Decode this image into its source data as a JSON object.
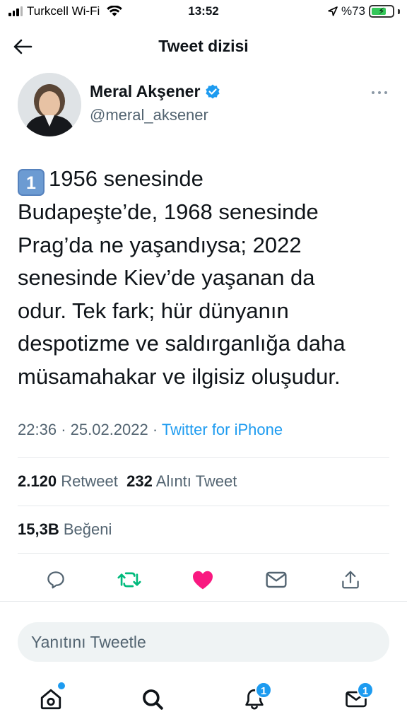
{
  "status_bar": {
    "carrier": "Turkcell Wi-Fi",
    "time": "13:52",
    "battery": "%73",
    "battery_level": 0.73
  },
  "header": {
    "title": "Tweet dizisi",
    "back_icon": "arrow-left-icon"
  },
  "tweet": {
    "author_name": "Meral Akşener",
    "author_handle": "@meral_aksener",
    "verified": true,
    "number_emoji": "1",
    "text": "1956 senesinde\nBudapeşte’de, 1968 senesinde\nPrag’da ne yaşandıysa; 2022\nsenesinde Kiev’de yaşanan da\nodur. Tek fark; hür dünyanın\ndespotizme ve saldırganlığa daha\nmüsamahakar ve ilgisiz oluşudur.",
    "time": "22:36",
    "date": "25.02.2022",
    "source": "Twitter for iPhone",
    "retweet_count": "2.120",
    "retweet_label": "Retweet",
    "quote_count": "232",
    "quote_label": "Alıntı Tweet",
    "like_count": "15,3B",
    "like_label": "Beğeni"
  },
  "actions": [
    {
      "name": "reply-icon"
    },
    {
      "name": "retweet-icon",
      "color": "#00ba7c"
    },
    {
      "name": "like-icon",
      "color": "#f91880"
    },
    {
      "name": "dm-share-icon"
    },
    {
      "name": "share-icon"
    }
  ],
  "reply": {
    "placeholder": "Yanıtını Tweetle"
  },
  "bottom_nav": {
    "home_icon": "home-icon",
    "search_icon": "search-icon",
    "notifications_icon": "bell-icon",
    "notifications_badge": "1",
    "messages_icon": "mail-icon",
    "messages_badge": "1"
  },
  "colors": {
    "accent": "#1d9bf0",
    "secondary_text": "#536471",
    "retweet_active": "#00ba7c",
    "like_active": "#f91880"
  }
}
